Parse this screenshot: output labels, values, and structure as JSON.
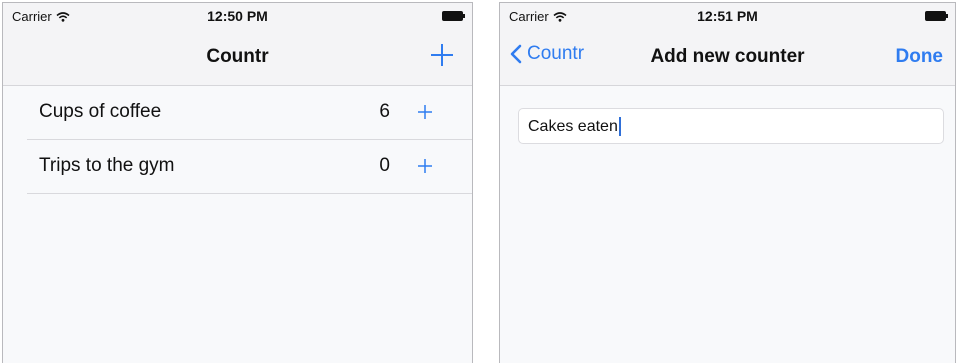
{
  "screens": [
    {
      "status": {
        "carrier": "Carrier",
        "time": "12:50 PM"
      },
      "nav": {
        "title": "Countr",
        "add_icon": "plus-icon"
      },
      "counters": [
        {
          "label": "Cups of coffee",
          "count": "6"
        },
        {
          "label": "Trips to the gym",
          "count": "0"
        }
      ]
    },
    {
      "status": {
        "carrier": "Carrier",
        "time": "12:51 PM"
      },
      "nav": {
        "back_label": "Countr",
        "title": "Add new counter",
        "done_label": "Done"
      },
      "new_counter_field": {
        "value": "Cakes eaten"
      }
    }
  ],
  "colors": {
    "accent": "#2f7cf0",
    "background": "#f8f9fb",
    "bar": "#f4f4f6"
  }
}
